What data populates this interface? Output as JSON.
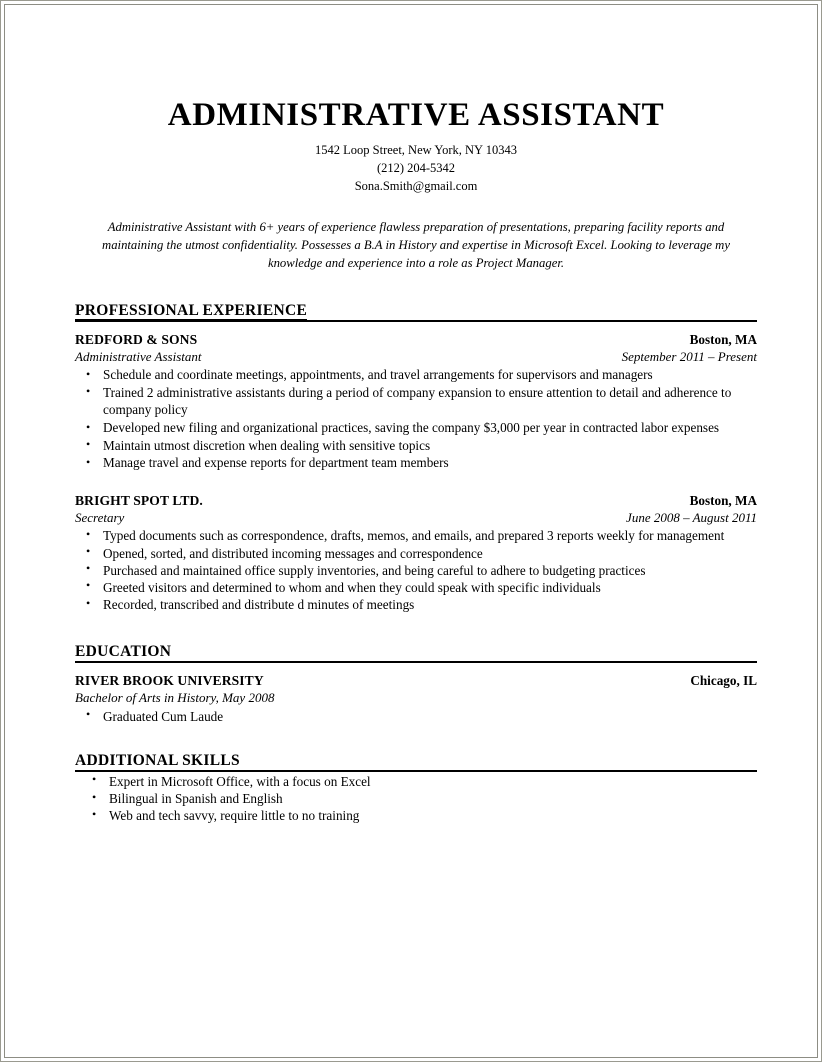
{
  "document": {
    "title": "ADMINISTRATIVE ASSISTANT",
    "contact": {
      "address": "1542 Loop Street, New York, NY 10343",
      "phone": "(212) 204-5342",
      "email": "Sona.Smith@gmail.com"
    },
    "summary": "Administrative Assistant with 6+ years of experience flawless preparation of presentations, preparing facility reports and maintaining the utmost confidentiality.  Possesses a B.A in History and expertise in Microsoft Excel. Looking to leverage my knowledge and experience into a role as Project Manager."
  },
  "sections": {
    "experience": {
      "heading": "PROFESSIONAL EXPERIENCE",
      "entries": [
        {
          "org": "REDFORD & SONS",
          "location": "Boston, MA",
          "role": "Administrative Assistant",
          "dates": "September 2011 – Present",
          "bullets": [
            "Schedule and coordinate meetings, appointments, and travel arrangements for supervisors and managers",
            "Trained 2 administrative assistants during a period of company expansion to ensure attention to detail and adherence to company policy",
            "Developed new filing and organizational practices, saving the company $3,000 per year in contracted labor expenses",
            "Maintain utmost discretion when dealing with sensitive topics",
            "Manage travel and expense reports for department team members"
          ]
        },
        {
          "org": "BRIGHT SPOT LTD.",
          "location": "Boston, MA",
          "role": "Secretary",
          "dates": "June 2008 – August 2011",
          "bullets": [
            "Typed documents such as correspondence, drafts, memos, and emails, and prepared 3 reports weekly for management",
            "Opened, sorted, and distributed incoming messages and correspondence",
            "Purchased and maintained office supply inventories, and being careful to adhere to budgeting practices",
            "Greeted visitors and determined to whom and when they could speak with specific individuals",
            "Recorded, transcribed and distribute d minutes of meetings"
          ]
        }
      ]
    },
    "education": {
      "heading": "EDUCATION",
      "entries": [
        {
          "org": "RIVER BROOK UNIVERSITY",
          "location": "Chicago, IL",
          "role": "Bachelor of Arts in History, May 2008",
          "dates": "",
          "bullets": [
            "Graduated Cum Laude"
          ]
        }
      ]
    },
    "skills": {
      "heading": "ADDITIONAL SKILLS",
      "bullets": [
        "Expert in Microsoft Office, with a focus on Excel",
        "Bilingual in Spanish and English",
        "Web and tech savvy, require little to no training"
      ]
    }
  }
}
